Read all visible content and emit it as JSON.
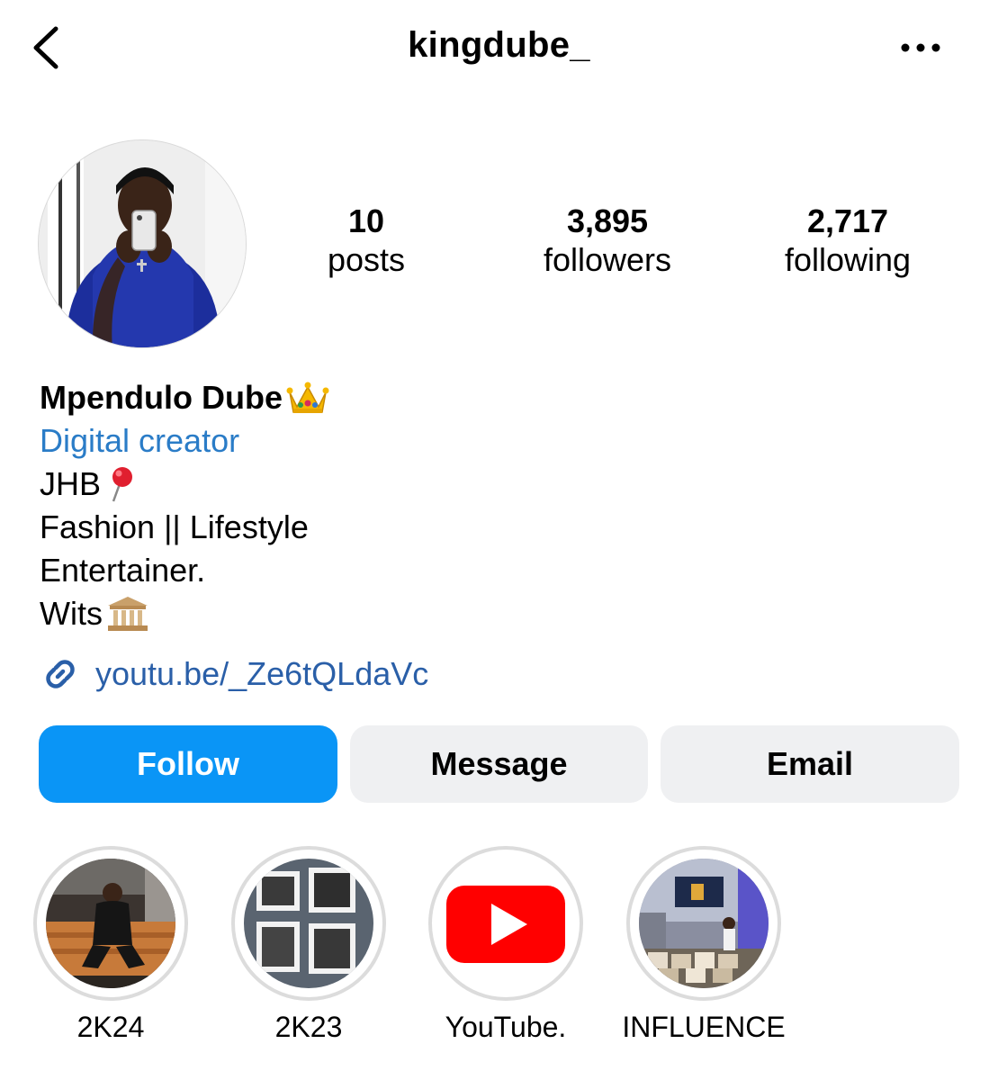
{
  "header": {
    "username": "kingdube_",
    "back_icon": "chevron-left-icon",
    "more_icon": "more-horizontal-icon"
  },
  "stats": {
    "posts": {
      "count": "10",
      "label": "posts"
    },
    "followers": {
      "count": "3,895",
      "label": "followers"
    },
    "following": {
      "count": "2,717",
      "label": "following"
    }
  },
  "bio": {
    "name": "Mpendulo Dube",
    "name_emoji": "crown-icon",
    "category": "Digital creator",
    "lines": [
      {
        "text": "JHB",
        "emoji": "pin-icon"
      },
      {
        "text": "Fashion || Lifestyle"
      },
      {
        "text": "Entertainer."
      },
      {
        "text": "Wits",
        "emoji": "classical-building-icon"
      }
    ],
    "link": "youtu.be/_Ze6tQLdaVc"
  },
  "buttons": {
    "follow": "Follow",
    "message": "Message",
    "email": "Email"
  },
  "highlights": [
    {
      "label": "2K24"
    },
    {
      "label": "2K23"
    },
    {
      "label": "YouTube."
    },
    {
      "label": "INFLUENCE"
    }
  ],
  "colors": {
    "accent_blue": "#0a95f6",
    "category_blue": "#2a7cc7",
    "link_blue": "#2a5fa8",
    "button_gray": "#eff0f2",
    "youtube_red": "#ff0000"
  }
}
